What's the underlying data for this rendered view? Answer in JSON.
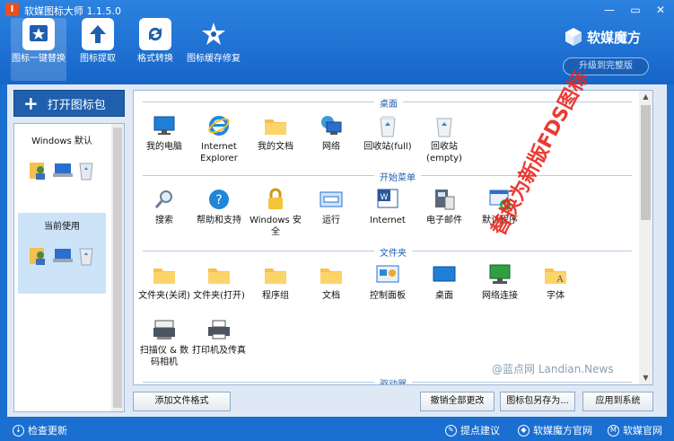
{
  "window": {
    "app_icon_letter": "I",
    "title": "软媒图标大师 1.1.5.0",
    "controls": [
      "—",
      "▭",
      "✕"
    ]
  },
  "toolbar": [
    {
      "label": "图标一键替换",
      "icon": "star-badge-icon"
    },
    {
      "label": "图标提取",
      "icon": "upload-arrow-icon"
    },
    {
      "label": "格式转换",
      "icon": "refresh-icon"
    },
    {
      "label": "图标缓存修复",
      "icon": "wrench-star-icon"
    }
  ],
  "brand": {
    "name": "软媒魔方",
    "upgrade": "升级到完整版"
  },
  "left": {
    "open_pack": "打开图标包",
    "themes": [
      {
        "name": "Windows 默认"
      },
      {
        "name": "当前使用"
      }
    ]
  },
  "sections": {
    "desktop": "桌面",
    "start_menu": "开始菜单",
    "folders": "文件夹",
    "drivers": "驱动器"
  },
  "desktop_items": [
    {
      "label": "我的电脑",
      "icon": "monitor-icon"
    },
    {
      "label": "Internet Explorer",
      "icon": "ie-icon"
    },
    {
      "label": "我的文档",
      "icon": "folder-icon"
    },
    {
      "label": "网络",
      "icon": "network-icon"
    },
    {
      "label": "回收站(full)",
      "icon": "recycle-bin-full-icon"
    },
    {
      "label": "回收站(empty)",
      "icon": "recycle-bin-empty-icon"
    }
  ],
  "start_items": [
    {
      "label": "搜索",
      "icon": "magnifier-icon"
    },
    {
      "label": "帮助和支持",
      "icon": "help-icon"
    },
    {
      "label": "Windows 安全",
      "icon": "lock-icon"
    },
    {
      "label": "运行",
      "icon": "run-icon"
    },
    {
      "label": "Internet",
      "icon": "internet-icon"
    },
    {
      "label": "电子邮件",
      "icon": "email-icon"
    },
    {
      "label": "默认程序",
      "icon": "default-programs-icon"
    }
  ],
  "folder_items": [
    {
      "label": "文件夹(关闭)",
      "icon": "folder-closed-icon"
    },
    {
      "label": "文件夹(打开)",
      "icon": "folder-open-icon"
    },
    {
      "label": "程序组",
      "icon": "program-group-icon"
    },
    {
      "label": "文档",
      "icon": "documents-icon"
    },
    {
      "label": "控制面板",
      "icon": "control-panel-icon"
    },
    {
      "label": "桌面",
      "icon": "desktop-icon"
    },
    {
      "label": "网络连接",
      "icon": "network-connection-icon"
    },
    {
      "label": "字体",
      "icon": "fonts-icon"
    },
    {
      "label": "扫描仪 & 数码相机",
      "icon": "scanner-icon"
    },
    {
      "label": "打印机及传真",
      "icon": "printer-icon"
    }
  ],
  "overlay": {
    "watermark": "替换为新版FDS图标",
    "credit": "@蓝点网 Landian.News"
  },
  "buttons": {
    "add_format": "添加文件格式",
    "undo_all": "撤销全部更改",
    "save_pack": "图标包另存为...",
    "apply": "应用到系统"
  },
  "status": {
    "check_update": "检查更新",
    "feedback": "提点建议",
    "site1": "软媒魔方官网",
    "site2": "软媒官网"
  },
  "colors": {
    "header": "#1a6fd1",
    "accent": "#1f5fae",
    "watermark": "#e8261f"
  }
}
